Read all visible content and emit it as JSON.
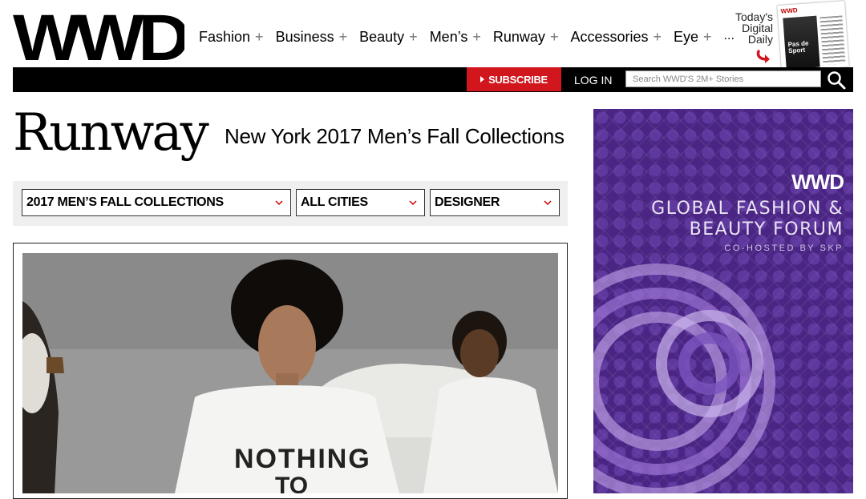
{
  "header": {
    "logo_text": "WWD",
    "nav": [
      {
        "label": "Fashion",
        "plus": "+"
      },
      {
        "label": "Business",
        "plus": "+"
      },
      {
        "label": "Beauty",
        "plus": "+"
      },
      {
        "label": "Men’s",
        "plus": "+"
      },
      {
        "label": "Runway",
        "plus": "+"
      },
      {
        "label": "Accessories",
        "plus": "+"
      },
      {
        "label": "Eye",
        "plus": "+"
      }
    ],
    "nav_more": "...",
    "digital_daily": {
      "line1": "Today's",
      "line2": "Digital",
      "line3": "Daily"
    },
    "magazine": {
      "masthead": "WWD",
      "cover_text_1": "Pas de",
      "cover_text_2": "Sport"
    }
  },
  "toolbar": {
    "subscribe_label": "SUBSCRIBE",
    "login_label": "LOG IN",
    "search_placeholder": "Search WWD'S 2M+ Stories"
  },
  "page": {
    "title": "Runway",
    "subtitle": "New York 2017 Men’s Fall Collections"
  },
  "filters": {
    "season": "2017 MEN’S FALL COLLECTIONS",
    "city": "ALL CITIES",
    "designer": "DESIGNER"
  },
  "gallery": {
    "shirt_text_1": "NOTHING",
    "shirt_text_2": "TO"
  },
  "ad": {
    "logo": "WWD",
    "line1": "GLOBAL FASHION &",
    "line2": "BEAUTY FORUM",
    "cohost": "CO-HOSTED BY SKP"
  },
  "colors": {
    "accent_red": "#d1161d",
    "ad_purple": "#4a2584"
  }
}
